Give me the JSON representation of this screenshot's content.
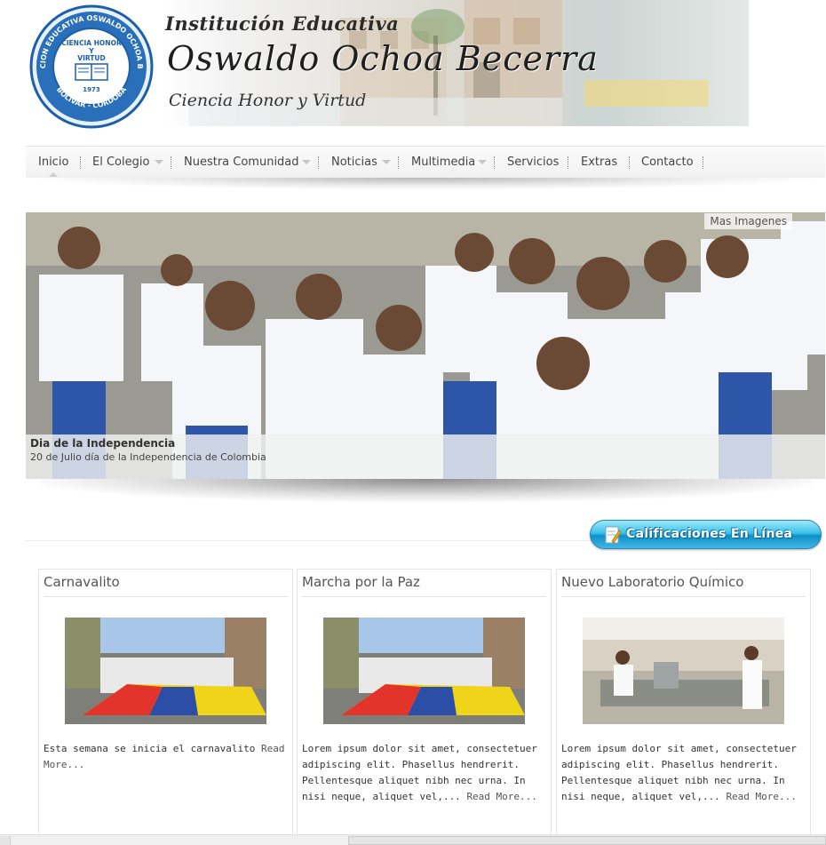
{
  "header": {
    "seal": {
      "ring_text": "INSTITUCION EDUCATIVA OSWALDO OCHOA BECERRA",
      "bottom_text": "BOLIVAR - CORDOBA",
      "motto": "CIENCIA HONOR Y VIRTUD",
      "year": "1973"
    },
    "line1": "Institución Educativa",
    "line2": "Oswaldo Ochoa Becerra",
    "line3": "Ciencia Honor y Virtud"
  },
  "nav": {
    "items": [
      {
        "label": "Inicio"
      },
      {
        "label": "El Colegio"
      },
      {
        "label": "Nuestra Comunidad"
      },
      {
        "label": "Noticias"
      },
      {
        "label": "Multimedia"
      },
      {
        "label": "Servicios"
      },
      {
        "label": "Extras"
      },
      {
        "label": "Contacto"
      }
    ]
  },
  "slideshow": {
    "more_link": "Mas Imagenes",
    "caption_title": "Dia de la Independencia",
    "caption_text": "20 de Julio día de la Independencia de Colombia"
  },
  "grades_button": {
    "label": "Calificaciones En Línea"
  },
  "cards": [
    {
      "title": "Carnavalito",
      "text": "Esta semana se inicia el carnavalito",
      "more": "Read More..."
    },
    {
      "title": "Marcha por la Paz",
      "text": "Lorem ipsum dolor sit amet, consectetuer adipiscing elit. Phasellus hendrerit. Pellentesque aliquet nibh nec urna. In nisi neque, aliquet vel,...",
      "more": "Read More..."
    },
    {
      "title": "Nuevo Laboratorio Químico",
      "text": "Lorem ipsum dolor sit amet, consectetuer adipiscing elit. Phasellus hendrerit. Pellentesque aliquet nibh nec urna. In nisi neque, aliquet vel,...",
      "more": "Read More..."
    }
  ],
  "colors": {
    "seal_blue": "#1c5fa8",
    "button_blue": "#1aa3d9",
    "nav_text": "#444444"
  }
}
